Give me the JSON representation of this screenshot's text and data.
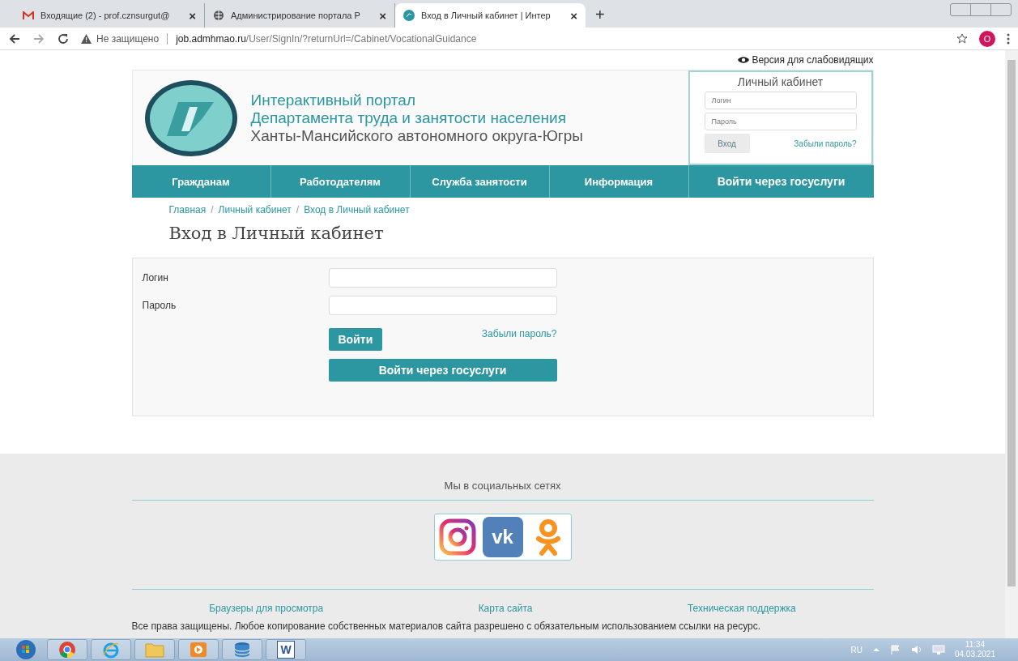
{
  "browser": {
    "tabs": [
      {
        "kind": "mail",
        "title": "Входящие (2) - prof.cznsurgut@",
        "selected": false
      },
      {
        "kind": "globe",
        "title": "Администрирование портала Р",
        "selected": false
      },
      {
        "kind": "site",
        "title": "Вход в Личный кабинет | Интер",
        "selected": true
      }
    ],
    "close_mark": "×",
    "new_tab": "+",
    "address": {
      "security": "Не защищено",
      "host": "job.admhmao.ru",
      "path": "/User/SignIn/?returnUrl=/Cabinet/VocationalGuidance"
    },
    "profile": "O"
  },
  "page": {
    "accessibility_link": "Версия для слабовидящих",
    "header": {
      "title_lines": [
        "Интерактивный портал",
        "Департамента труда и занятости населения",
        "Ханты-Мансийского автономного округа-Югры"
      ]
    },
    "login_box": {
      "title": "Личный кабинет",
      "login_placeholder": "Логин",
      "password_placeholder": "Пароль",
      "button": "Вход",
      "forgot": "Забыли пароль?"
    },
    "nav": [
      {
        "label": "Гражданам"
      },
      {
        "label": "Работодателям"
      },
      {
        "label": "Служба занятости"
      },
      {
        "label": "Информация"
      },
      {
        "label": "Войти через госуслуги"
      }
    ],
    "breadcrumbs": [
      "Главная",
      "Личный кабинет",
      "Вход в Личный кабинет"
    ],
    "breadcrumb_separator": "/",
    "heading": "Вход в Личный кабинет",
    "form": {
      "fields": [
        {
          "label": "Логин"
        },
        {
          "label": "Пароль"
        }
      ],
      "submit": "Войти",
      "forgot": "Забыли пароль?",
      "gosuslugi": "Войти через госуслуги"
    },
    "footer": {
      "social_title": "Мы в социальных сетях",
      "socials": [
        {
          "kind": "instagram"
        },
        {
          "kind": "vk",
          "text": "vk"
        },
        {
          "kind": "ok"
        }
      ],
      "links": [
        "Браузеры для просмотра",
        "Карта сайта",
        "Техническая поддержка"
      ],
      "copyright": "Все права защищены. Любое копирование собственных материалов сайта разрешено с обязательным использованием ссылки на ресурс."
    }
  },
  "taskbar": {
    "apps": [
      {
        "kind": "start"
      },
      {
        "kind": "chrome"
      },
      {
        "kind": "ie"
      },
      {
        "kind": "folder"
      },
      {
        "kind": "media"
      },
      {
        "kind": "database"
      },
      {
        "kind": "word",
        "text": "W"
      }
    ],
    "language": "RU",
    "time": "11:34",
    "date": "04.03.2021"
  }
}
